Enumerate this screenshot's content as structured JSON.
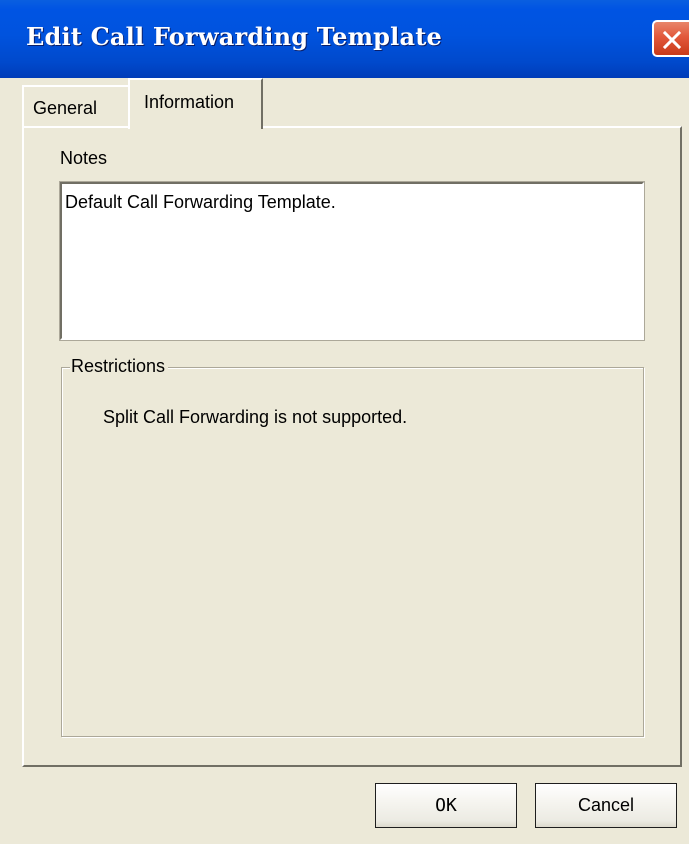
{
  "window": {
    "title": "Edit Call Forwarding Template",
    "close_icon": "close-icon",
    "accent_color": "#0054e3",
    "close_color": "#e2583b"
  },
  "tabs": [
    {
      "label": "General",
      "selected": false
    },
    {
      "label": "Information",
      "selected": true
    }
  ],
  "notes": {
    "label": "Notes",
    "value": "Default Call Forwarding Template."
  },
  "restrictions": {
    "label": "Restrictions",
    "text": "Split Call Forwarding is not supported."
  },
  "buttons": {
    "ok_label": "OK",
    "cancel_label": "Cancel"
  }
}
